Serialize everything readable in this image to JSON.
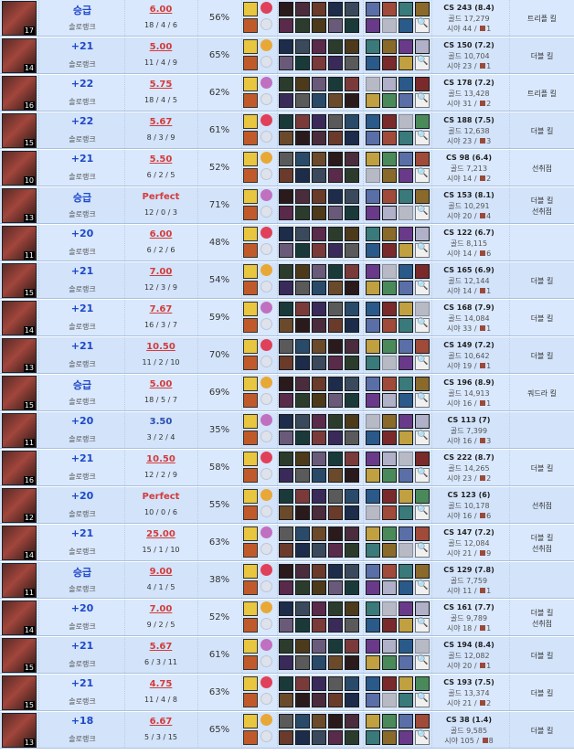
{
  "rows": [
    {
      "lp": "승급",
      "queue": "솔로랭크",
      "kda": "6.00",
      "kda_style": "red",
      "kda_line": "18 / 4 / 6",
      "kp": "56%",
      "cs": "CS 243 (8.4)",
      "gold": "골드 17,279",
      "vision": "시야 44 / ",
      "pinks": "1",
      "tags": [
        "트리플 킬"
      ],
      "level": "17"
    },
    {
      "lp": "+21",
      "queue": "솔로랭크",
      "kda": "5.00",
      "kda_style": "red",
      "kda_line": "11 / 4 / 9",
      "kp": "65%",
      "cs": "CS 150 (7.2)",
      "gold": "골드 10,704",
      "vision": "시야 23 / ",
      "pinks": "1",
      "tags": [
        "더블 킬"
      ],
      "level": "14"
    },
    {
      "lp": "+22",
      "queue": "솔로랭크",
      "kda": "5.75",
      "kda_style": "red",
      "kda_line": "18 / 4 / 5",
      "kp": "62%",
      "cs": "CS 178 (7.2)",
      "gold": "골드 13,428",
      "vision": "시야 31 / ",
      "pinks": "2",
      "tags": [
        "트리플 킬"
      ],
      "level": "16"
    },
    {
      "lp": "+22",
      "queue": "솔로랭크",
      "kda": "5.67",
      "kda_style": "red",
      "kda_line": "8 / 3 / 9",
      "kp": "61%",
      "cs": "CS 188 (7.5)",
      "gold": "골드 12,638",
      "vision": "시야 23 / ",
      "pinks": "3",
      "tags": [
        "더블 킬"
      ],
      "level": "15"
    },
    {
      "lp": "+21",
      "queue": "솔로랭크",
      "kda": "5.50",
      "kda_style": "red",
      "kda_line": "6 / 2 / 5",
      "kp": "52%",
      "cs": "CS 98 (6.4)",
      "gold": "골드 7,213",
      "vision": "시야 14 / ",
      "pinks": "2",
      "tags": [
        "선취점"
      ],
      "level": "10"
    },
    {
      "lp": "승급",
      "queue": "솔로랭크",
      "kda": "Perfect",
      "kda_style": "perfect",
      "kda_line": "12 / 0 / 3",
      "kp": "71%",
      "cs": "CS 153 (8.1)",
      "gold": "골드 10,291",
      "vision": "시야 20 / ",
      "pinks": "4",
      "tags": [
        "더블 킬",
        "선취점"
      ],
      "level": "13"
    },
    {
      "lp": "+20",
      "queue": "솔로랭크",
      "kda": "6.00",
      "kda_style": "red",
      "kda_line": "6 / 2 / 6",
      "kp": "48%",
      "cs": "CS 122 (6.7)",
      "gold": "골드 8,115",
      "vision": "시야 14 / ",
      "pinks": "6",
      "tags": [],
      "level": "11"
    },
    {
      "lp": "+21",
      "queue": "솔로랭크",
      "kda": "7.00",
      "kda_style": "red",
      "kda_line": "12 / 3 / 9",
      "kp": "54%",
      "cs": "CS 165 (6.9)",
      "gold": "골드 12,144",
      "vision": "시야 14 / ",
      "pinks": "1",
      "tags": [
        "더블 킬"
      ],
      "level": "15"
    },
    {
      "lp": "+21",
      "queue": "솔로랭크",
      "kda": "7.67",
      "kda_style": "red",
      "kda_line": "16 / 3 / 7",
      "kp": "59%",
      "cs": "CS 168 (7.9)",
      "gold": "골드 14,084",
      "vision": "시야 33 / ",
      "pinks": "1",
      "tags": [
        "더블 킬"
      ],
      "level": "14"
    },
    {
      "lp": "+21",
      "queue": "솔로랭크",
      "kda": "10.50",
      "kda_style": "red",
      "kda_line": "11 / 2 / 10",
      "kp": "70%",
      "cs": "CS 149 (7.2)",
      "gold": "골드 10,642",
      "vision": "시야 19 / ",
      "pinks": "1",
      "tags": [
        "더블 킬"
      ],
      "level": "13"
    },
    {
      "lp": "승급",
      "queue": "솔로랭크",
      "kda": "5.00",
      "kda_style": "red",
      "kda_line": "18 / 5 / 7",
      "kp": "69%",
      "cs": "CS 196 (8.9)",
      "gold": "골드 14,913",
      "vision": "시야 16 / ",
      "pinks": "1",
      "tags": [
        "쿼드라 킬"
      ],
      "level": "15"
    },
    {
      "lp": "+20",
      "queue": "솔로랭크",
      "kda": "3.50",
      "kda_style": "blue",
      "kda_line": "3 / 2 / 4",
      "kp": "35%",
      "cs": "CS 113 (7)",
      "gold": "골드 7,399",
      "vision": "시야 16 / ",
      "pinks": "3",
      "tags": [],
      "level": "11"
    },
    {
      "lp": "+21",
      "queue": "솔로랭크",
      "kda": "10.50",
      "kda_style": "red",
      "kda_line": "12 / 2 / 9",
      "kp": "58%",
      "cs": "CS 222 (8.7)",
      "gold": "골드 14,265",
      "vision": "시야 23 / ",
      "pinks": "2",
      "tags": [
        "더블 킬"
      ],
      "level": "16"
    },
    {
      "lp": "+20",
      "queue": "솔로랭크",
      "kda": "Perfect",
      "kda_style": "perfect",
      "kda_line": "10 / 0 / 6",
      "kp": "55%",
      "cs": "CS 123 (6)",
      "gold": "골드 10,178",
      "vision": "시야 16 / ",
      "pinks": "6",
      "tags": [
        "선취점"
      ],
      "level": "12"
    },
    {
      "lp": "+21",
      "queue": "솔로랭크",
      "kda": "25.00",
      "kda_style": "red",
      "kda_line": "15 / 1 / 10",
      "kp": "63%",
      "cs": "CS 147 (7.2)",
      "gold": "골드 12,084",
      "vision": "시야 21 / ",
      "pinks": "9",
      "tags": [
        "더블 킬",
        "선취점"
      ],
      "level": "14"
    },
    {
      "lp": "승급",
      "queue": "솔로랭크",
      "kda": "9.00",
      "kda_style": "red",
      "kda_line": "4 / 1 / 5",
      "kp": "38%",
      "cs": "CS 129 (7.8)",
      "gold": "골드 7,759",
      "vision": "시야 11 / ",
      "pinks": "1",
      "tags": [],
      "level": "11"
    },
    {
      "lp": "+20",
      "queue": "솔로랭크",
      "kda": "7.00",
      "kda_style": "red",
      "kda_line": "9 / 2 / 5",
      "kp": "52%",
      "cs": "CS 161 (7.7)",
      "gold": "골드 9,789",
      "vision": "시야 18 / ",
      "pinks": "1",
      "tags": [
        "더블 킬",
        "선취점"
      ],
      "level": "14"
    },
    {
      "lp": "+21",
      "queue": "솔로랭크",
      "kda": "5.67",
      "kda_style": "red",
      "kda_line": "6 / 3 / 11",
      "kp": "61%",
      "cs": "CS 194 (8.4)",
      "gold": "골드 12,082",
      "vision": "시야 20 / ",
      "pinks": "1",
      "tags": [
        "더블 킬"
      ],
      "level": "15"
    },
    {
      "lp": "+21",
      "queue": "솔로랭크",
      "kda": "4.75",
      "kda_style": "red",
      "kda_line": "11 / 4 / 8",
      "kp": "63%",
      "cs": "CS 193 (7.5)",
      "gold": "골드 13,374",
      "vision": "시야 21 / ",
      "pinks": "2",
      "tags": [
        "더블 킬"
      ],
      "level": "15"
    },
    {
      "lp": "+18",
      "queue": "솔로랭크",
      "kda": "6.67",
      "kda_style": "red",
      "kda_line": "5 / 3 / 15",
      "kp": "65%",
      "cs": "CS 38 (1.4)",
      "gold": "골드 9,585",
      "vision": "시야 105 / ",
      "pinks": "8",
      "tags": [
        "더블 킬"
      ],
      "level": "13"
    }
  ],
  "colors": {
    "lp": "#1e48c8",
    "kda_red": "#d23c3c",
    "kda_blue": "#2b4fb0",
    "row_bg": "#d9e8fc",
    "pink_ward": "#9a4a3a"
  },
  "icons": {
    "spell": "flash-icon",
    "ward": "search-icon"
  }
}
